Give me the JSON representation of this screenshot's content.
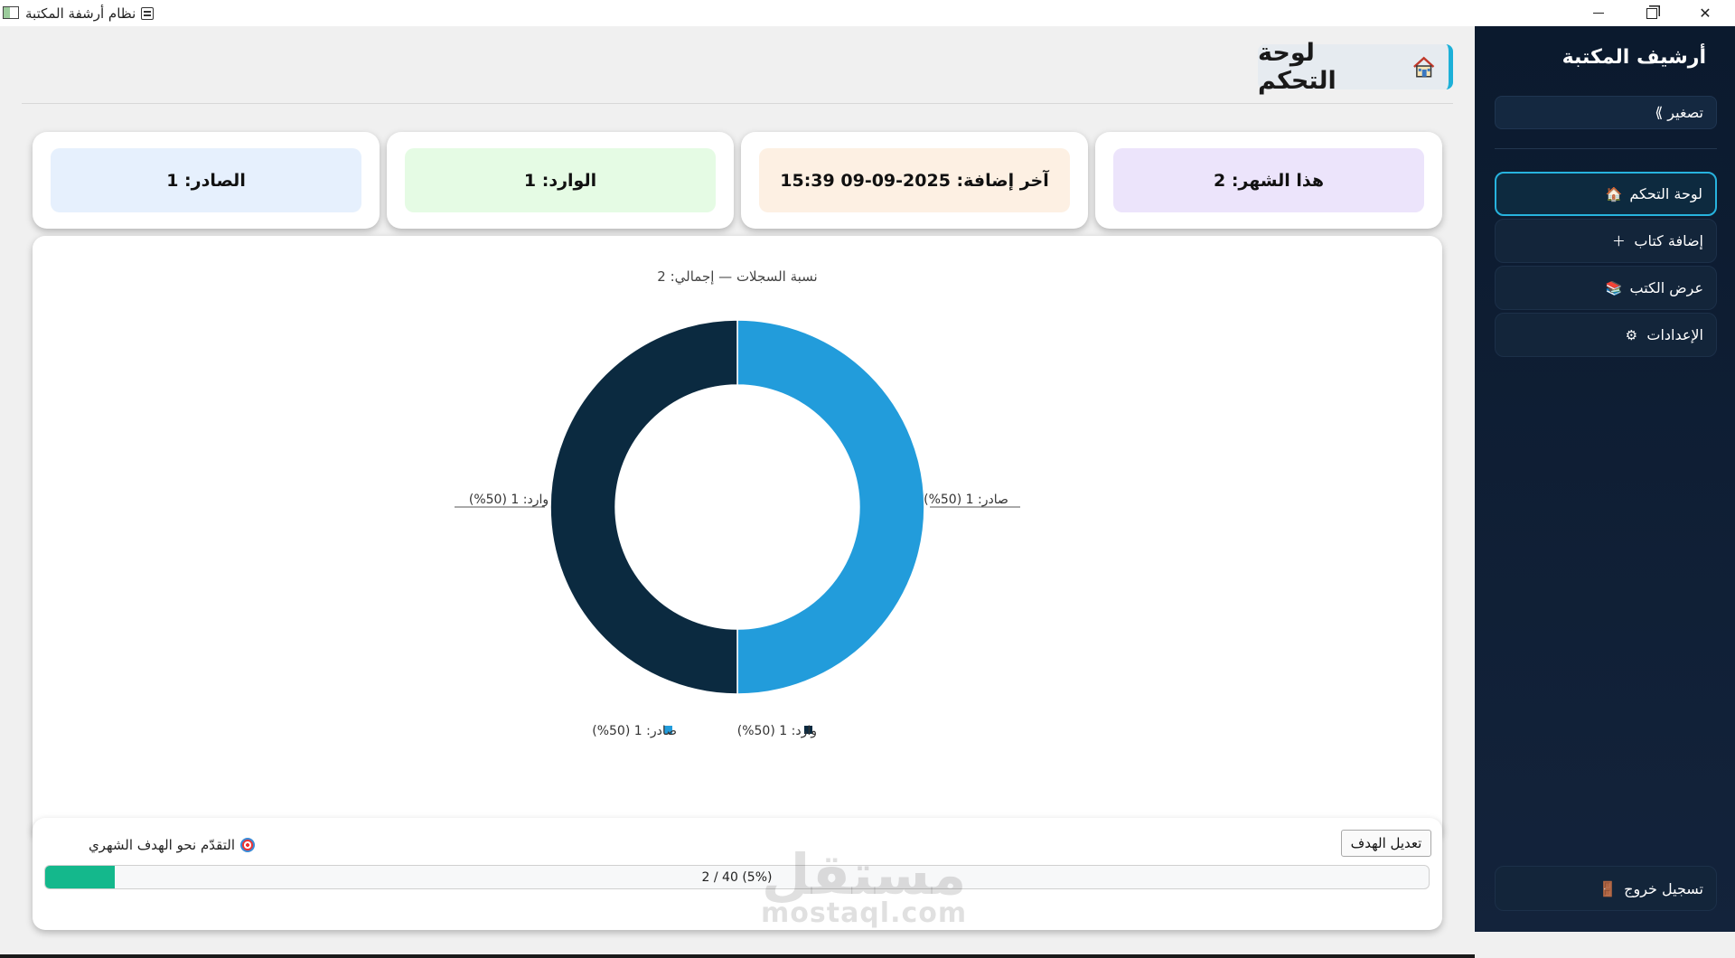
{
  "window": {
    "title": "نظام أرشفة المكتبة"
  },
  "sidebar": {
    "brand": "أرشيف المكتبة",
    "collapse_label": "تصغير ⟫",
    "items": [
      {
        "label": "لوحة التحكم",
        "icon": "🏠",
        "active": true
      },
      {
        "label": "إضافة كتاب",
        "icon": "＋"
      },
      {
        "label": "عرض الكتب",
        "icon": "📚"
      },
      {
        "label": "الإعدادات",
        "icon": "⚙"
      }
    ],
    "logout": {
      "label": "تسجيل خروج",
      "icon": "🚪"
    }
  },
  "page": {
    "title": "لوحة التحكم",
    "icon": "house-icon"
  },
  "stats": [
    {
      "label": "هذا الشهر: 2",
      "bg": "#ece4fb"
    },
    {
      "label": "آخر إضافة: 2025-09-09 15:39",
      "bg": "#fdf0e3"
    },
    {
      "label": "الوارد: 1",
      "bg": "#e5fbe4"
    },
    {
      "label": "الصادر: 1",
      "bg": "#e6f0fd"
    }
  ],
  "chart_data": {
    "type": "pie",
    "title": "نسبة السجلات — إجمالي: 2",
    "slices": [
      {
        "name": "صادر",
        "value": 1,
        "percent": 50,
        "color": "#229cdb",
        "label": "صادر: 1 (50%)"
      },
      {
        "name": "وارد",
        "value": 1,
        "percent": 50,
        "color": "#0b2a40",
        "label": "وارد: 1 (50%)"
      }
    ],
    "donut": true,
    "legend_position": "bottom",
    "legend": [
      "صادر: 1 (50%)",
      "وارد: 1 (50%)"
    ]
  },
  "progress": {
    "title": "التقدّم نحو الهدف الشهري",
    "edit_button": "تعديل الهدف",
    "value": 2,
    "goal": 40,
    "fraction": 0.05,
    "text": "2 / 40 (5%)"
  },
  "watermark": {
    "arabic": "مستقل",
    "latin": "mostaql.com"
  }
}
